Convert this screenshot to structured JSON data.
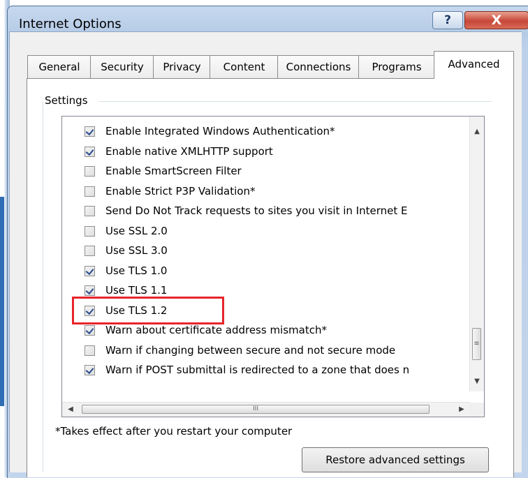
{
  "window": {
    "title": "Internet Options",
    "help_glyph": "?",
    "close_glyph": "X"
  },
  "tabs": [
    {
      "label": "General",
      "active": false
    },
    {
      "label": "Security",
      "active": false
    },
    {
      "label": "Privacy",
      "active": false
    },
    {
      "label": "Content",
      "active": false
    },
    {
      "label": "Connections",
      "active": false
    },
    {
      "label": "Programs",
      "active": false
    },
    {
      "label": "Advanced",
      "active": true
    }
  ],
  "settings": {
    "group_label": "Settings",
    "items": [
      {
        "label": "Enable Integrated Windows Authentication*",
        "checked": true
      },
      {
        "label": "Enable native XMLHTTP support",
        "checked": true
      },
      {
        "label": "Enable SmartScreen Filter",
        "checked": false
      },
      {
        "label": "Enable Strict P3P Validation*",
        "checked": false
      },
      {
        "label": "Send Do Not Track requests to sites you visit in Internet E",
        "checked": false
      },
      {
        "label": "Use SSL 2.0",
        "checked": false
      },
      {
        "label": "Use SSL 3.0",
        "checked": false
      },
      {
        "label": "Use TLS 1.0",
        "checked": true
      },
      {
        "label": "Use TLS 1.1",
        "checked": true
      },
      {
        "label": "Use TLS 1.2",
        "checked": true
      },
      {
        "label": "Warn about certificate address mismatch*",
        "checked": true
      },
      {
        "label": "Warn if changing between secure and not secure mode",
        "checked": false
      },
      {
        "label": "Warn if POST submittal is redirected to a zone that does n",
        "checked": true
      }
    ],
    "highlighted_item": "Use TLS 1.2",
    "scroll": {
      "up_glyph": "▲",
      "down_glyph": "▼",
      "left_glyph": "◀",
      "right_glyph": "▶",
      "v_grip": "≡",
      "h_grip": "III"
    }
  },
  "footer": {
    "note": "*Takes effect after you restart your computer",
    "restore_button": "Restore advanced settings"
  },
  "colors": {
    "highlight_box": "#e8242b",
    "checkmark": "#2a4c8f",
    "close_button": "#c7473a"
  }
}
